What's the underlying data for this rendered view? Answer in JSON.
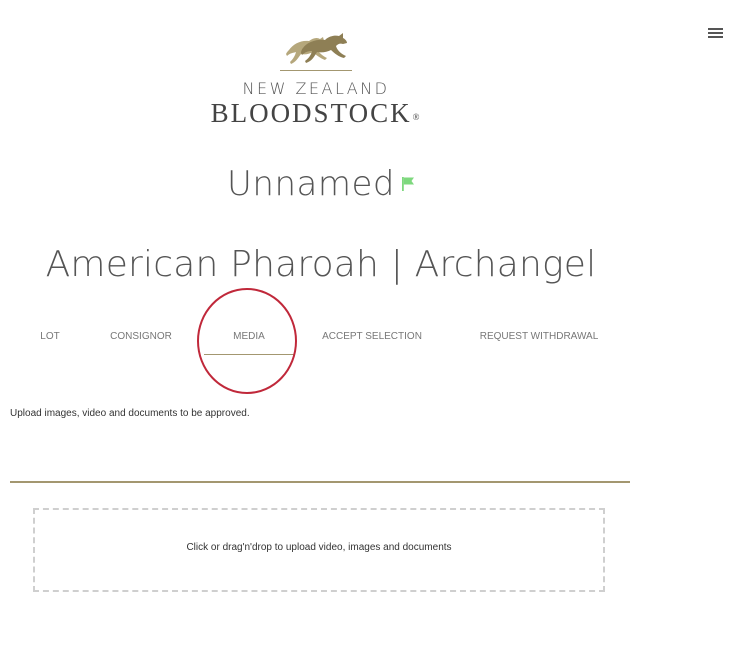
{
  "header": {
    "logo_line1": "NEW ZEALAND",
    "logo_line2": "BLOODSTOCK",
    "logo_registered": "®",
    "menu_icon": "hamburger-menu-icon"
  },
  "horse": {
    "name": "Unnamed",
    "flag_icon": "flag-icon",
    "flag_color": "#7ed87e",
    "pedigree": "American Pharoah | Archangel"
  },
  "tabs": [
    {
      "label": "LOT",
      "active": false
    },
    {
      "label": "CONSIGNOR",
      "active": false
    },
    {
      "label": "MEDIA",
      "active": true
    },
    {
      "label": "ACCEPT SELECTION",
      "active": false
    },
    {
      "label": "REQUEST WITHDRAWAL",
      "active": false
    }
  ],
  "media": {
    "instructions": "Upload images, video and documents to be approved.",
    "dropzone_label": "Click or drag'n'drop to upload video, images and documents"
  },
  "colors": {
    "accent_gold": "#a39770",
    "highlight_circle": "#c0283a"
  }
}
